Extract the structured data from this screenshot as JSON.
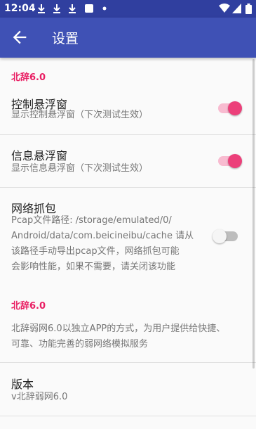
{
  "status_bar": {
    "time": "12:04",
    "icons": [
      "download-icon",
      "download-icon",
      "download-icon",
      "app-icon",
      "dot-icon",
      "wifi-icon",
      "signal-icon",
      "battery-icon"
    ]
  },
  "app_bar": {
    "title": "设置",
    "back_icon": "arrow-back-icon"
  },
  "sections": {
    "cat1": "北辞6.0",
    "control_float": {
      "title": "控制悬浮窗",
      "summary": "显示控制悬浮窗（下次测试生效）",
      "enabled": true
    },
    "info_float": {
      "title": "信息悬浮窗",
      "summary": "显示信息悬浮窗（下次测试生效）",
      "enabled": true
    },
    "capture": {
      "title": "网络抓包",
      "summary_lines": [
        "Pcap文件路径: /storage/emulated/0/",
        "Android/data/com.beicineibu/cache 请从",
        "该路径手动导出pcap文件，网络抓包可能",
        "会影响性能，如果不需要，请关闭该功能"
      ],
      "enabled": false
    },
    "cat2": "北辞6.0",
    "about_lines": [
      "北辞弱网6.0以独立APP的方式，为用户提供给快捷、",
      "可靠、功能完善的弱网络模拟服务"
    ],
    "version": {
      "title": "版本",
      "value": "v北辞弱网6.0"
    }
  },
  "colors": {
    "primary": "#3f51b5",
    "primary_dark": "#303f9f",
    "accent": "#ec407a"
  }
}
